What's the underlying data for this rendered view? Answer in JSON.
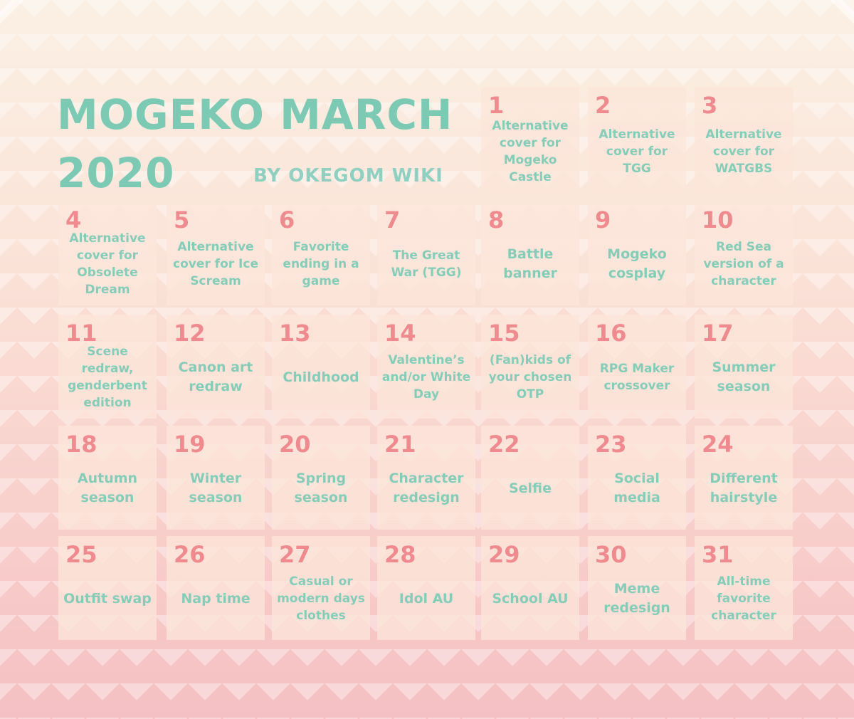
{
  "header": {
    "title_line1": "MOGEKO MARCH",
    "title_line2": "2020",
    "subtitle": "BY OKEGOM WIKI"
  },
  "colors": {
    "title": "#7cc9b4",
    "day_number": "#ef8a8f",
    "prompt_text": "#85cdb9",
    "cell_background": "#fde6da"
  },
  "days": [
    {
      "n": "1",
      "t": "Alternative cover for Mogeko Castle"
    },
    {
      "n": "2",
      "t": "Alternative cover for TGG"
    },
    {
      "n": "3",
      "t": "Alternative cover for WATGBS"
    },
    {
      "n": "4",
      "t": "Alternative cover for Obsolete Dream"
    },
    {
      "n": "5",
      "t": "Alternative cover for Ice Scream"
    },
    {
      "n": "6",
      "t": "Favorite ending in a game"
    },
    {
      "n": "7",
      "t": "The Great War (TGG)"
    },
    {
      "n": "8",
      "t": "Battle banner"
    },
    {
      "n": "9",
      "t": "Mogeko cosplay"
    },
    {
      "n": "10",
      "t": "Red Sea version of a character"
    },
    {
      "n": "11",
      "t": "Scene redraw, genderbent edition"
    },
    {
      "n": "12",
      "t": "Canon art redraw"
    },
    {
      "n": "13",
      "t": "Childhood"
    },
    {
      "n": "14",
      "t": "Valentine’s and/or White Day"
    },
    {
      "n": "15",
      "t": "(Fan)kids of your chosen OTP"
    },
    {
      "n": "16",
      "t": "RPG Maker crossover"
    },
    {
      "n": "17",
      "t": "Summer season"
    },
    {
      "n": "18",
      "t": "Autumn season"
    },
    {
      "n": "19",
      "t": "Winter season"
    },
    {
      "n": "20",
      "t": "Spring season"
    },
    {
      "n": "21",
      "t": "Character redesign"
    },
    {
      "n": "22",
      "t": "Selfie"
    },
    {
      "n": "23",
      "t": "Social media"
    },
    {
      "n": "24",
      "t": "Different hairstyle"
    },
    {
      "n": "25",
      "t": "Outfit swap"
    },
    {
      "n": "26",
      "t": "Nap time"
    },
    {
      "n": "27",
      "t": "Casual or modern days clothes"
    },
    {
      "n": "28",
      "t": "Idol AU"
    },
    {
      "n": "29",
      "t": "School AU"
    },
    {
      "n": "30",
      "t": "Meme redesign"
    },
    {
      "n": "31",
      "t": "All-time favorite character"
    }
  ]
}
